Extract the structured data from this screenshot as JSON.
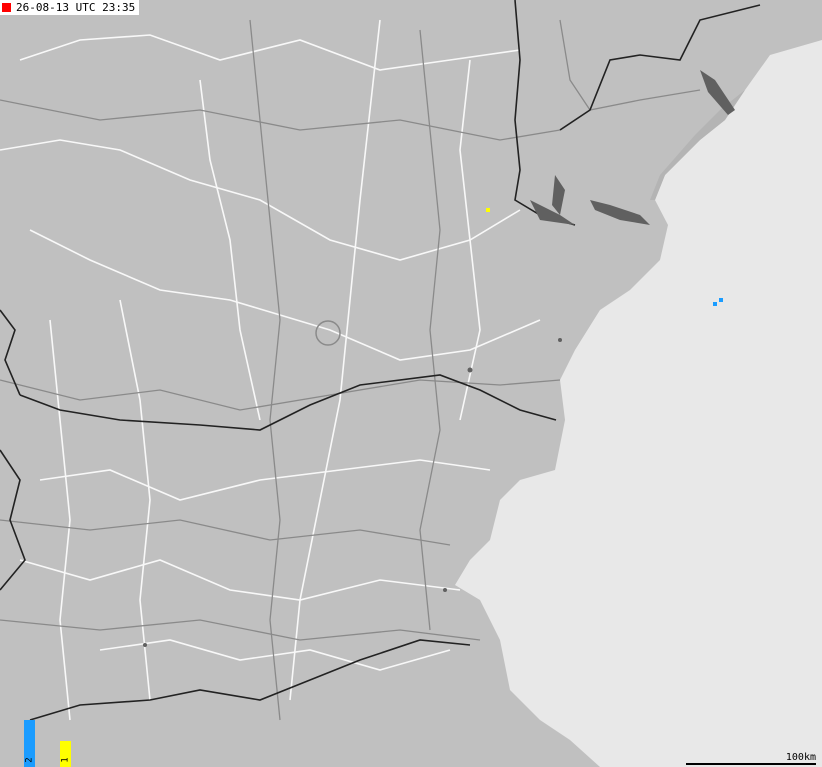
{
  "timestamp": "26-08-13 UTC 23:35",
  "colors": {
    "land": "#c0c0c0",
    "sea": "#e8e8e8",
    "border": "#222222",
    "roads": "#ffffff",
    "rivers": "#8a8a8a",
    "lakes": "#606060",
    "recent_marker": "#ff0000",
    "strike_old": "#1a9cff",
    "strike_new": "#ffff00"
  },
  "legend": [
    {
      "label": "2",
      "color": "#1a9cff",
      "count": 2
    },
    {
      "label": "1",
      "color": "#ffff00",
      "count": 1
    }
  ],
  "scale_label": "100km"
}
